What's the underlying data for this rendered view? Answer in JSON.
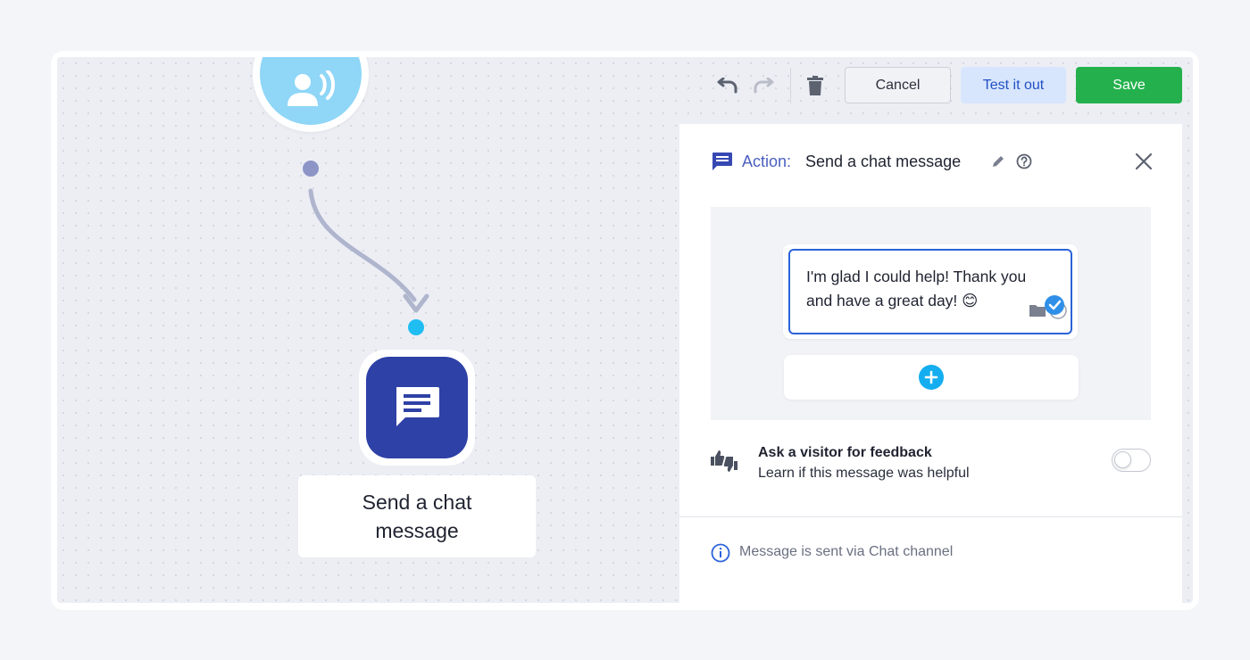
{
  "toolbar": {
    "undo_icon": "undo-icon",
    "redo_icon": "redo-icon",
    "delete_icon": "trash-icon",
    "cancel_label": "Cancel",
    "test_label": "Test it out",
    "save_label": "Save"
  },
  "canvas": {
    "trigger_icon": "person-speaking-icon",
    "action_icon": "chat-message-icon",
    "action_node_label": "Send a chat message"
  },
  "panel": {
    "header_prefix": "Action:",
    "header_title": "Send a chat message",
    "message_text": "I'm glad I could help! Thank you and have a great day! 😊",
    "feedback_title": "Ask a visitor for feedback",
    "feedback_subtitle": "Learn if this message was helpful",
    "feedback_enabled": false,
    "info_text": "Message is sent via Chat channel"
  },
  "colors": {
    "accent": "#2e41a6",
    "save": "#24b14d",
    "test_bg": "#d7e6fc",
    "trigger": "#8fd6f7",
    "add_button": "#14aef0"
  }
}
